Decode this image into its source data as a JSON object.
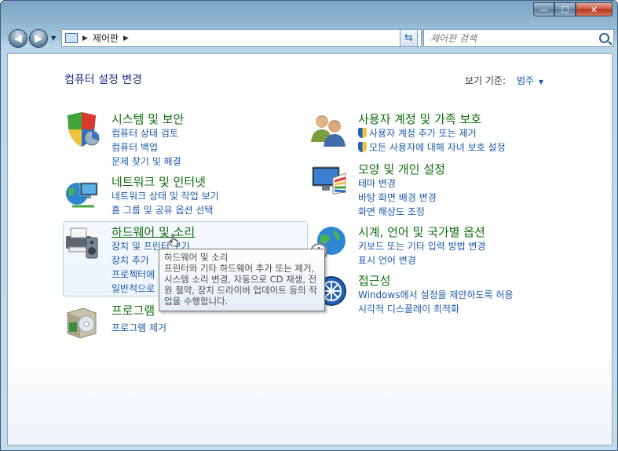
{
  "window": {
    "caption_buttons": {
      "minimize": "—",
      "maximize": "☐",
      "close": "✕"
    }
  },
  "nav": {
    "address_path": "제어판",
    "search_placeholder": "제어판 검색"
  },
  "main": {
    "title": "컴퓨터 설정 변경",
    "view_by_label": "보기 기준:",
    "view_by_value": "범주"
  },
  "categories": {
    "system": {
      "title": "시스템 및 보안",
      "links": [
        "컴퓨터 상태 검토",
        "컴퓨터 백업",
        "문제 찾기 및 해결"
      ]
    },
    "network": {
      "title": "네트워크 및 인터넷",
      "links": [
        "네트워크 상태 및 작업 보기",
        "홈 그룹 및 공유 옵션 선택"
      ]
    },
    "hardware": {
      "title": "하드웨어 및 소리",
      "links": [
        "장치 및 프린터 보기",
        "장치 추가",
        "프로젝터에",
        "일반적으로"
      ]
    },
    "programs": {
      "title": "프로그램",
      "links": [
        "프로그램 제거"
      ]
    },
    "users": {
      "title": "사용자 계정 및 가족 보호",
      "links": [
        "사용자 계정 추가 또는 제거",
        "모든 사용자에 대해 자녀 보호 설정"
      ]
    },
    "appearance": {
      "title": "모양 및 개인 설정",
      "links": [
        "테마 변경",
        "바탕 화면 배경 변경",
        "화면 해상도 조정"
      ]
    },
    "clock": {
      "title": "시계, 언어 및 국가별 옵션",
      "links": [
        "키보드 또는 기타 입력 방법 변경",
        "표시 언어 변경"
      ]
    },
    "access": {
      "title": "접근성",
      "links": [
        "Windows에서 설정을 제안하도록 허용",
        "시각적 디스플레이 최적화"
      ]
    }
  },
  "tooltip": {
    "text": "하드웨어 및 소리\n프린터와 기타 하드웨어 추가 또는 제거, 시스템 소리 변경, 자동으로 CD 재생, 전원 절약, 장치 드라이버 업데이트 등의 작업을 수행합니다."
  },
  "icons": {
    "system": "shield-icon",
    "network": "globe-network-icon",
    "hardware": "printer-speaker-icon",
    "programs": "program-box-icon",
    "users": "users-icon",
    "appearance": "monitor-palette-icon",
    "clock": "clock-globe-icon",
    "access": "accessibility-icon"
  }
}
